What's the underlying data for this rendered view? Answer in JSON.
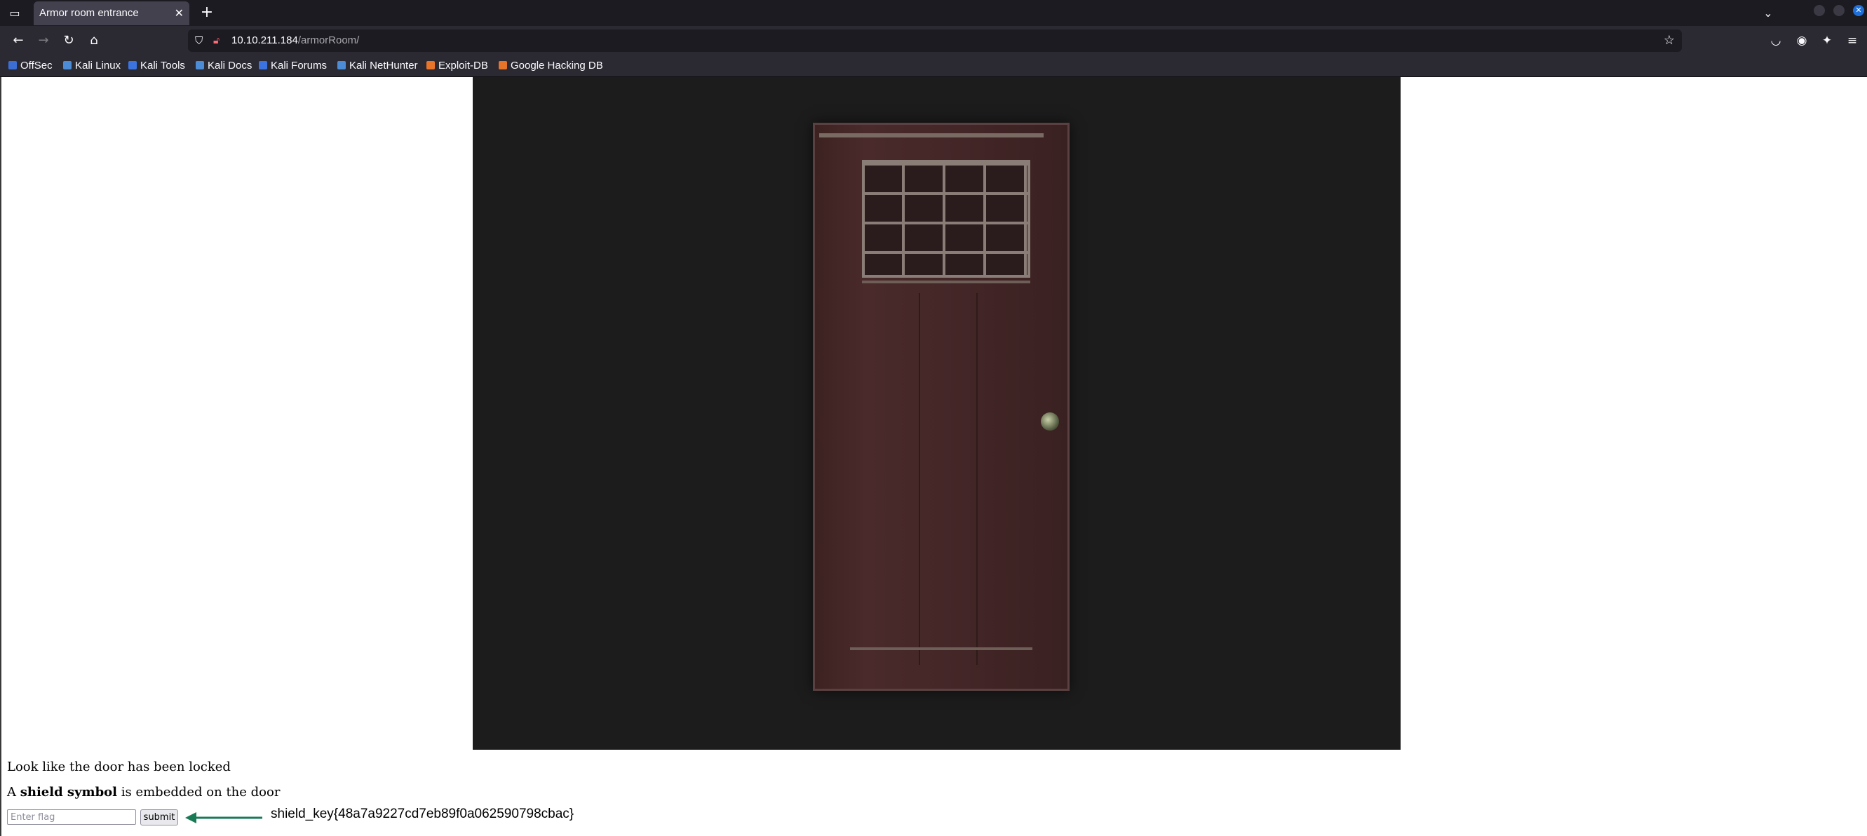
{
  "browser": {
    "tab_title": "Armor room entrance",
    "tab_close_icon": "close-icon",
    "new_tab_icon": "plus-icon",
    "url_host": "10.10.211.184",
    "url_path": "/armorRoom/",
    "bookmarks": [
      {
        "label": "OffSec",
        "color": "#3b6fd6"
      },
      {
        "label": "Kali Linux",
        "color": "#4c8bd6"
      },
      {
        "label": "Kali Tools",
        "color": "#3b74e0"
      },
      {
        "label": "Kali Docs",
        "color": "#4c8bd6"
      },
      {
        "label": "Kali Forums",
        "color": "#3b74e0"
      },
      {
        "label": "Kali NetHunter",
        "color": "#4c8bd6"
      },
      {
        "label": "Exploit-DB",
        "color": "#e8742a"
      },
      {
        "label": "Google Hacking DB",
        "color": "#e8742a"
      }
    ]
  },
  "page": {
    "line_locked": "Look like the door has been locked",
    "line_shield_prefix": "A ",
    "line_shield_bold": "shield symbol",
    "line_shield_suffix": " is embedded on the door",
    "flag_placeholder": "Enter flag",
    "submit_label": "submit",
    "annotation_text": "shield_key{48a7a9227cd7eb89f0a062590798cbac}",
    "annotation_color": "#1a7a55"
  }
}
